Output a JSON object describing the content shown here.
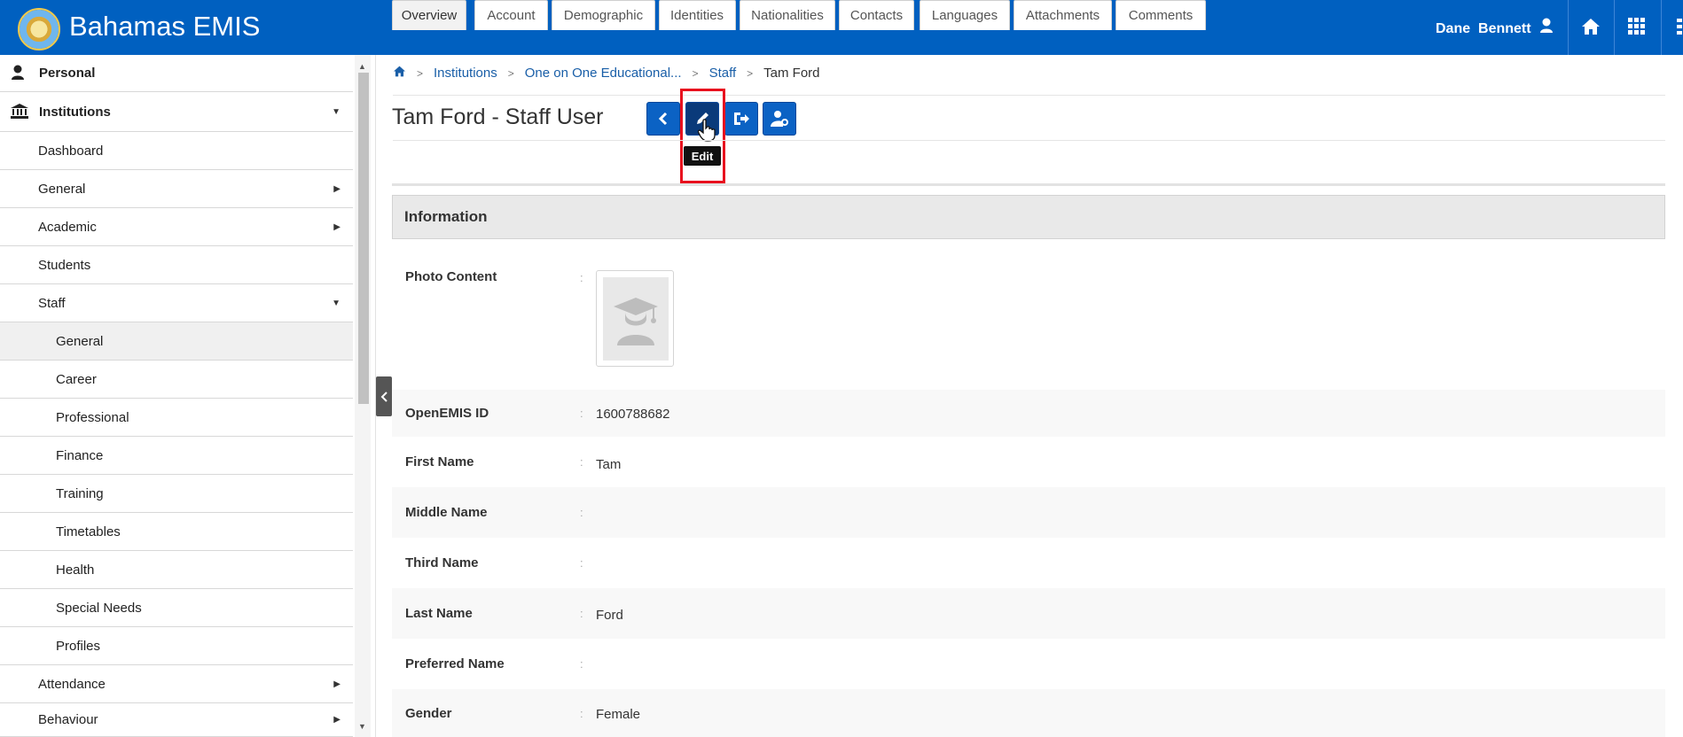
{
  "header": {
    "app_title": "Bahamas EMIS",
    "user_first": "Dane",
    "user_last": "Bennett",
    "brand_color": "#0060c0"
  },
  "sidebar": {
    "items": [
      {
        "label": "Personal",
        "icon": "person-icon"
      },
      {
        "label": "Institutions",
        "icon": "institution-icon"
      },
      {
        "label": "Dashboard"
      },
      {
        "label": "General"
      },
      {
        "label": "Academic"
      },
      {
        "label": "Students"
      },
      {
        "label": "Staff"
      },
      {
        "label": "General"
      },
      {
        "label": "Career"
      },
      {
        "label": "Professional"
      },
      {
        "label": "Finance"
      },
      {
        "label": "Training"
      },
      {
        "label": "Timetables"
      },
      {
        "label": "Health"
      },
      {
        "label": "Special Needs"
      },
      {
        "label": "Profiles"
      },
      {
        "label": "Attendance"
      },
      {
        "label": "Behaviour"
      }
    ]
  },
  "breadcrumb": {
    "items": [
      "Institutions",
      "One on One Educational...",
      "Staff"
    ],
    "current": "Tam Ford"
  },
  "page": {
    "title": "Tam Ford - Staff User",
    "tooltip": "Edit"
  },
  "tabs": [
    "Overview",
    "Account",
    "Demographic",
    "Identities",
    "Nationalities",
    "Contacts",
    "Languages",
    "Attachments",
    "Comments"
  ],
  "section": {
    "title": "Information"
  },
  "fields": [
    {
      "label": "Photo Content",
      "value": ""
    },
    {
      "label": "OpenEMIS ID",
      "value": "1600788682"
    },
    {
      "label": "First Name",
      "value": "Tam"
    },
    {
      "label": "Middle Name",
      "value": ""
    },
    {
      "label": "Third Name",
      "value": ""
    },
    {
      "label": "Last Name",
      "value": "Ford"
    },
    {
      "label": "Preferred Name",
      "value": ""
    },
    {
      "label": "Gender",
      "value": "Female"
    }
  ]
}
